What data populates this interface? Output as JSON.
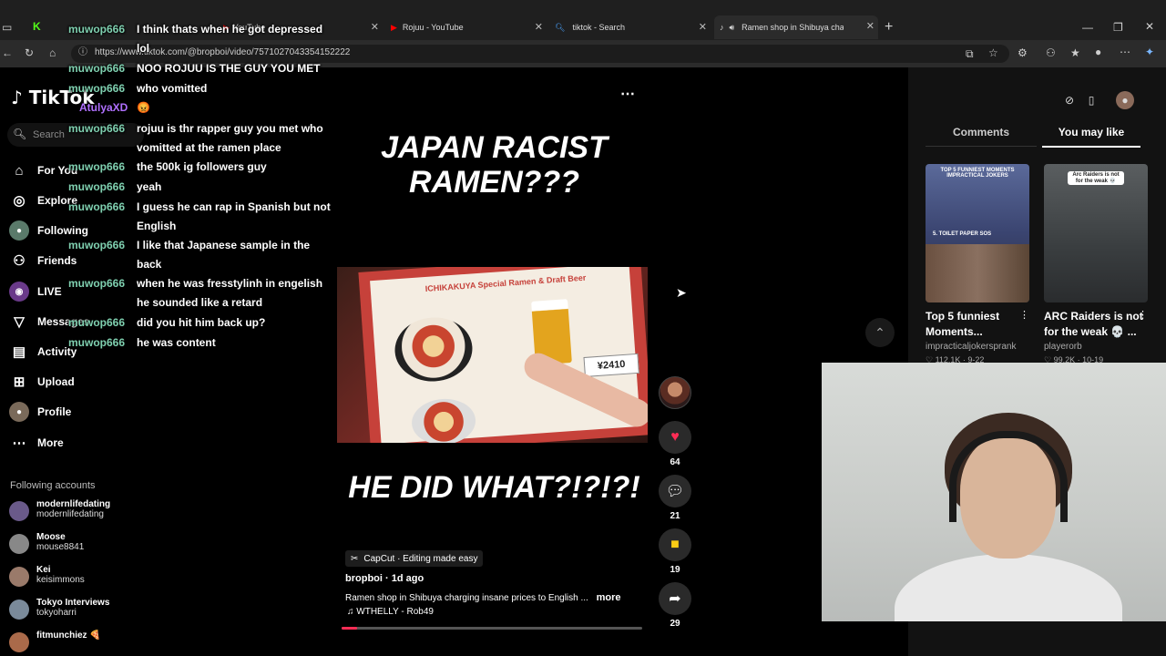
{
  "browser": {
    "tabs": [
      {
        "title": "Rojuu - YouTube",
        "active": false
      },
      {
        "title": "tiktok - Search",
        "active": false
      },
      {
        "title": "Ramen shop in Shibuya cha",
        "active": true
      }
    ],
    "partial_tab_title": "YouTube",
    "url": "https://www.tiktok.com/@bropboi/video/7571027043354152222"
  },
  "tiktok": {
    "logo": "TikTok",
    "search_placeholder": "Search",
    "nav": [
      {
        "label": "For You",
        "icon": "home-icon"
      },
      {
        "label": "Explore",
        "icon": "compass-icon"
      },
      {
        "label": "Following",
        "icon": "following-avatar-icon"
      },
      {
        "label": "Friends",
        "icon": "friends-icon"
      },
      {
        "label": "LIVE",
        "icon": "live-icon"
      },
      {
        "label": "Messages",
        "icon": "send-icon"
      },
      {
        "label": "Activity",
        "icon": "activity-icon"
      },
      {
        "label": "Upload",
        "icon": "upload-icon"
      },
      {
        "label": "Profile",
        "icon": "profile-avatar-icon"
      },
      {
        "label": "More",
        "icon": "more-icon"
      }
    ],
    "following_title": "Following accounts",
    "following_accounts": [
      {
        "name": "modernlifedating",
        "user": "modernlifedating",
        "color": "#6a5a8a"
      },
      {
        "name": "Moose",
        "user": "mouse8841",
        "color": "#888888"
      },
      {
        "name": "Kei",
        "user": "keisimmons",
        "color": "#9a7a6a"
      },
      {
        "name": "Tokyo Interviews",
        "user": "tokyoharri",
        "color": "#7a8a9a"
      },
      {
        "name": "fitmunchiez 🍕",
        "user": "",
        "color": "#aa6a4a"
      }
    ]
  },
  "chat": [
    {
      "user": "muwop666",
      "message": "I think thats when he got depressed lol"
    },
    {
      "user": "muwop666",
      "message": "NOO ROJUU IS THE GUY YOU MET"
    },
    {
      "user": "muwop666",
      "message": "who vomitted"
    },
    {
      "user": "AtulyaXD",
      "message": "😡"
    },
    {
      "user": "muwop666",
      "message": "rojuu is thr rapper guy you met who vomitted at the ramen place"
    },
    {
      "user": "muwop666",
      "message": "the 500k ig followers guy"
    },
    {
      "user": "muwop666",
      "message": "yeah"
    },
    {
      "user": "muwop666",
      "message": "I guess he can rap in Spanish but not English"
    },
    {
      "user": "muwop666",
      "message": "I like that Japanese sample in the back"
    },
    {
      "user": "muwop666",
      "message": "when he was fresstylinh in engelish he sounded like a retard"
    },
    {
      "user": "muwop666",
      "message": "did you hit him back up?"
    },
    {
      "user": "muwop666",
      "message": "he was content"
    }
  ],
  "video": {
    "top_caption": "JAPAN RACIST RAMEN???",
    "bottom_caption": "HE DID WHAT?!?!?!",
    "menu_label": "ICHIKAKUYA Special Ramen & Draft Beer",
    "price_tag": "¥2410",
    "capcut_label": "CapCut · Editing made easy",
    "author_line": "bropboi · 1d ago",
    "description": "Ramen shop in Shibuya charging insane prices to English ...",
    "more_label": "more",
    "sound": "WTHELLY - Rob49",
    "progress": 0.05,
    "likes": "64",
    "comments": "21",
    "saves": "19",
    "shares": "29"
  },
  "right_panel": {
    "tab_comments": "Comments",
    "tab_you_may_like": "You may like",
    "recommendations": [
      {
        "thumb_label": "TOP 5 FUNNIEST MOMENTS IMPRACTICAL JOKERS",
        "thumb_sub": "5. TOILET PAPER SOS",
        "title": "Top 5 funniest Moments...",
        "author": "impracticaljokersprank",
        "stats": "♡ 112.1K · 9-22"
      },
      {
        "thumb_label": "Arc Raiders is not for the weak 💀",
        "thumb_sub": "",
        "title": "ARC Raiders is not for the weak 💀 ...",
        "author": "playerorb",
        "stats": "♡ 99.2K · 10-19"
      }
    ]
  }
}
